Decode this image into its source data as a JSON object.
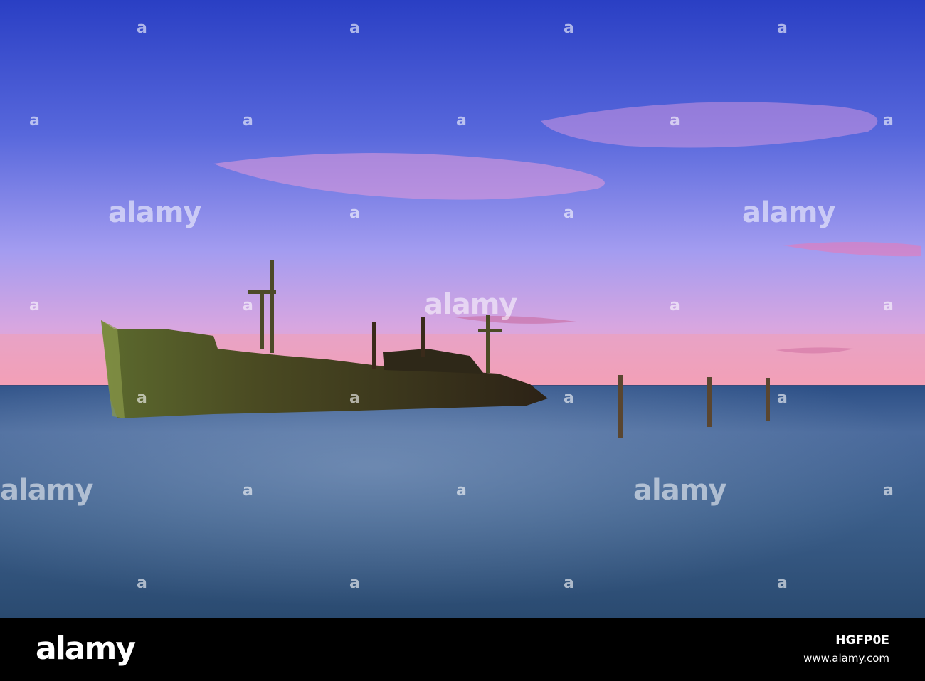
{
  "watermark": {
    "word": "alamy",
    "letter": "a"
  },
  "footer": {
    "logo": "alamy",
    "image_id": "HGFP0E",
    "url": "www.alamy.com"
  },
  "colors": {
    "sky_top": "#2f44c8",
    "sky_mid": "#8a8ff0",
    "horizon": "#f0a0c8",
    "sea": "#3a5a8a",
    "ship": "#3a3a22"
  }
}
